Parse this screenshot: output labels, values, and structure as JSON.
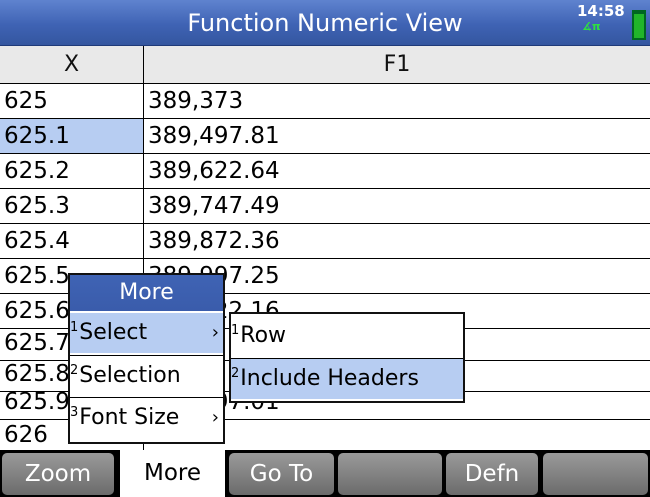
{
  "title_bar": {
    "title": "Function Numeric View",
    "clock": "14:58",
    "angle_indicator": "∡π"
  },
  "table": {
    "headers": {
      "x": "X",
      "f1": "F1"
    },
    "rows": [
      {
        "x": "625",
        "f1": "389,373"
      },
      {
        "x": "625.1",
        "f1": "389,497.81"
      },
      {
        "x": "625.2",
        "f1": "389,622.64"
      },
      {
        "x": "625.3",
        "f1": "389,747.49"
      },
      {
        "x": "625.4",
        "f1": "389,872.36"
      },
      {
        "x": "625.5",
        "f1": "389,997.25"
      },
      {
        "x": "625.6",
        "f1": "390,122.16"
      },
      {
        "x": "625.7",
        "f1": ""
      },
      {
        "x": "625.8",
        "f1": ""
      },
      {
        "x": "625.9",
        "f1": "390,497.01"
      },
      {
        "x": "626",
        "f1": ""
      }
    ]
  },
  "menu": {
    "title": "More",
    "items": [
      {
        "num": "1",
        "label": "Select",
        "arrow": "›"
      },
      {
        "num": "2",
        "label": "Selection",
        "arrow": ""
      },
      {
        "num": "3",
        "label": "Font Size",
        "arrow": "›"
      }
    ]
  },
  "submenu": {
    "items": [
      {
        "num": "1",
        "label": "Row"
      },
      {
        "num": "2",
        "label": "Include Headers"
      }
    ]
  },
  "softkeys": [
    "Zoom",
    "More",
    "Go To",
    "",
    "Defn",
    ""
  ]
}
